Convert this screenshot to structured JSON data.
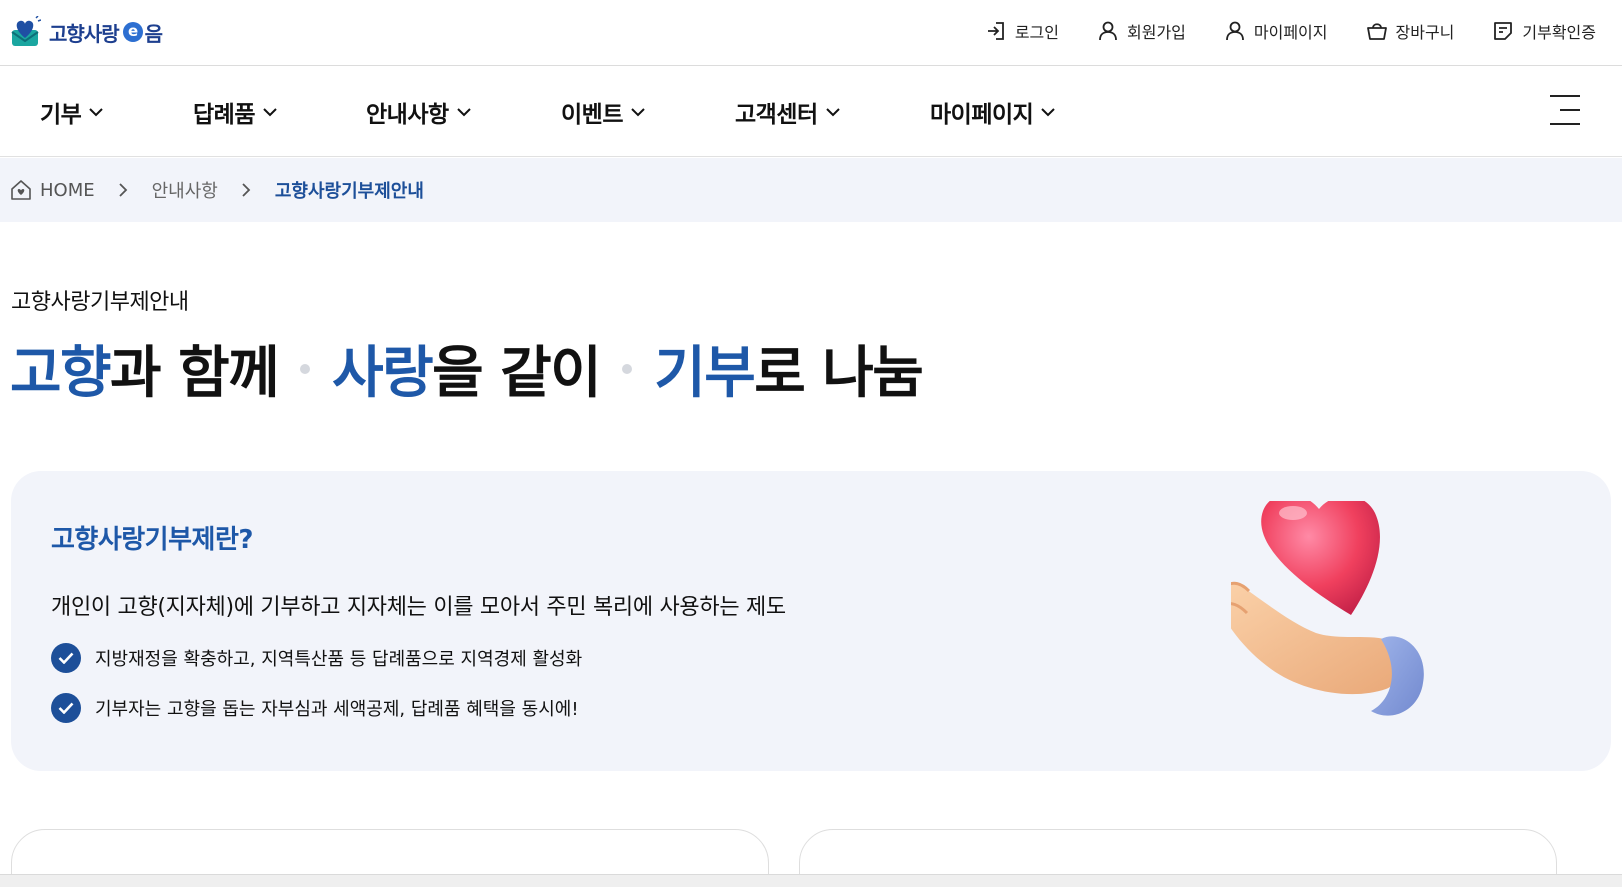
{
  "logo": {
    "text": "고향사랑",
    "e": "e",
    "suffix": "음"
  },
  "utility_menu": [
    {
      "label": "로그인",
      "icon": "login-icon"
    },
    {
      "label": "회원가입",
      "icon": "user-icon"
    },
    {
      "label": "마이페이지",
      "icon": "user-icon"
    },
    {
      "label": "장바구니",
      "icon": "basket-icon"
    },
    {
      "label": "기부확인증",
      "icon": "certificate-icon"
    }
  ],
  "gnb": [
    {
      "label": "기부"
    },
    {
      "label": "답례품"
    },
    {
      "label": "안내사항"
    },
    {
      "label": "이벤트"
    },
    {
      "label": "고객센터"
    },
    {
      "label": "마이페이지"
    }
  ],
  "breadcrumb": {
    "home": "HOME",
    "parent": "안내사항",
    "current": "고향사랑기부제안내"
  },
  "page": {
    "subtitle": "고향사랑기부제안내",
    "headline": {
      "p1_hl": "고향",
      "p1_rest": "과 함께",
      "p2_hl": "사랑",
      "p2_rest": "을 같이",
      "p3_hl": "기부",
      "p3_rest": "로 나눔"
    }
  },
  "info_card": {
    "title": "고향사랑기부제란?",
    "description": "개인이 고향(지자체)에 기부하고 지자체는 이를 모아서 주민 복리에 사용하는 제도",
    "points": [
      "지방재정을 확충하고, 지역특산품 등 답례품으로 지역경제 활성화",
      "기부자는 고향을 돕는 자부심과 세액공제, 답례품 혜택을 동시에!"
    ]
  },
  "colors": {
    "brand": "#1e58a8",
    "dark_blue": "#1d4f99",
    "card_bg": "#f2f4fa"
  }
}
